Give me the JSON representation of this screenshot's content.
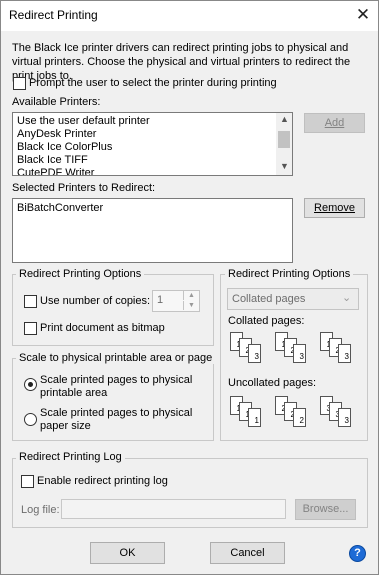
{
  "window": {
    "title": "Redirect Printing"
  },
  "description": "The Black Ice printer drivers can redirect printing jobs to physical and virtual printers. Choose the physical and virtual printers to redirect the print jobs to.",
  "prompt_checkbox": {
    "label": "Prompt the user to select the printer during printing",
    "checked": false
  },
  "available_printers": {
    "label": "Available Printers:",
    "items": [
      "Use the user default printer",
      "AnyDesk Printer",
      "Black Ice ColorPlus",
      "Black Ice TIFF",
      "CutePDF Writer"
    ],
    "add_label": "Add"
  },
  "selected_printers": {
    "label": "Selected Printers to Redirect:",
    "items": [
      "BiBatchConverter"
    ],
    "remove_label": "Remove"
  },
  "options_left": {
    "title": "Redirect Printing Options",
    "copies_label": "Use number of copies:",
    "copies_value": "1",
    "bitmap_label": "Print document as bitmap"
  },
  "options_right": {
    "title": "Redirect Printing Options",
    "dropdown_value": "Collated pages",
    "collated_label": "Collated pages:",
    "uncollated_label": "Uncollated pages:",
    "collated_sets": [
      [
        "1",
        "2",
        "3"
      ],
      [
        "1",
        "2",
        "3"
      ],
      [
        "1",
        "2",
        "3"
      ]
    ],
    "uncollated_sets": [
      [
        "1",
        "1",
        "1"
      ],
      [
        "2",
        "2",
        "2"
      ],
      [
        "3",
        "3",
        "3"
      ]
    ]
  },
  "scale": {
    "title": "Scale to physical printable area or page",
    "option1": "Scale printed pages to physical printable area",
    "option2": "Scale printed pages to physical paper size",
    "selected": 1
  },
  "log": {
    "title": "Redirect Printing Log",
    "enable_label": "Enable redirect printing log",
    "file_label": "Log file:",
    "browse_label": "Browse..."
  },
  "buttons": {
    "ok": "OK",
    "cancel": "Cancel"
  },
  "icons": {
    "close": "close-icon",
    "help": "help-icon"
  },
  "colors": {
    "accent": "#1e6bd6"
  }
}
